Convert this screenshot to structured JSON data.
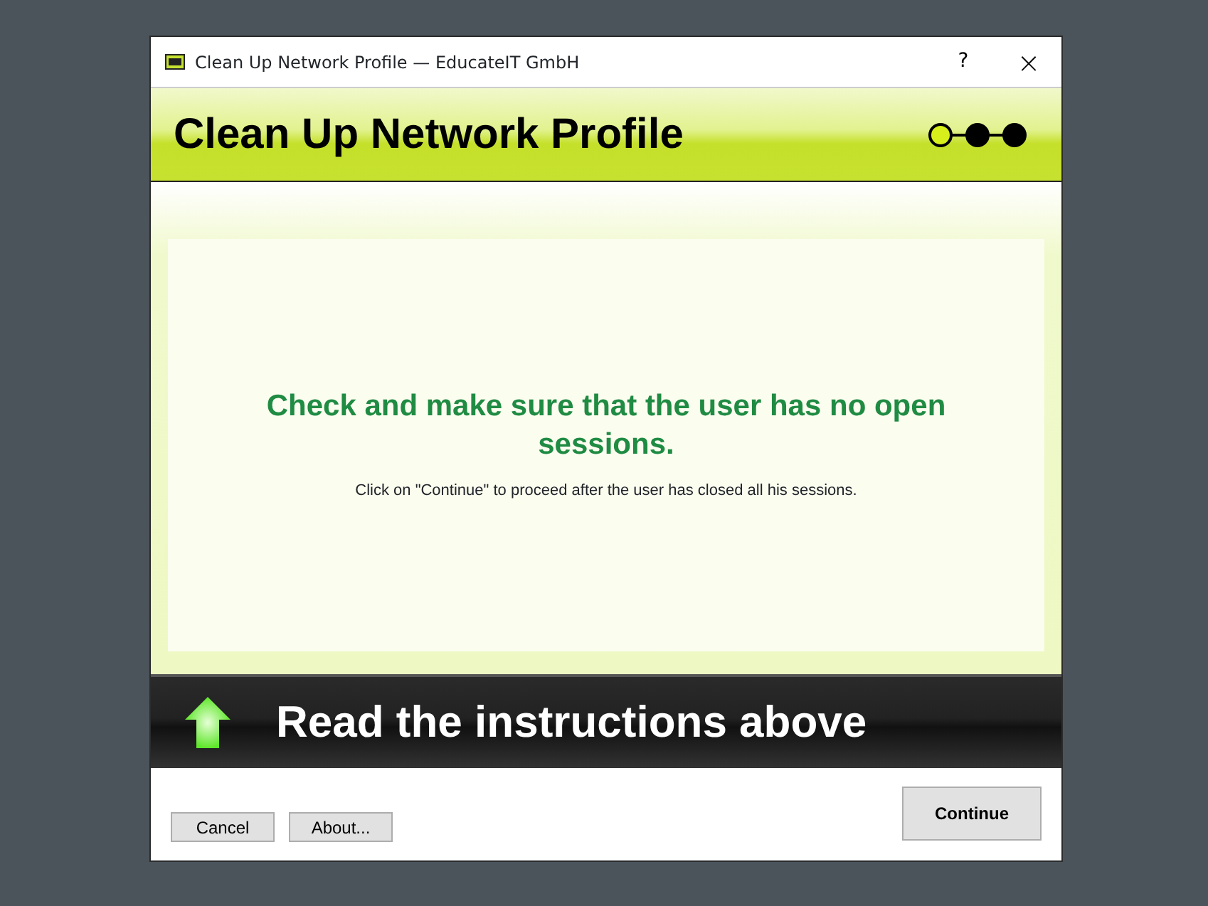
{
  "window": {
    "title": "Clean Up Network Profile — EducateIT GmbH",
    "help": "?",
    "close": "×"
  },
  "header": {
    "title": "Clean Up Network Profile",
    "steps": [
      {
        "selected": true
      },
      {
        "selected": false
      },
      {
        "selected": false
      }
    ]
  },
  "message": {
    "heading": "Check and make sure that the user has no open sessions.",
    "text": "Click on \"Continue\" to proceed after the user has closed all his sessions."
  },
  "banner": {
    "text": "Read the instructions above"
  },
  "buttons": [
    {
      "label": "Cancel",
      "kind": "small"
    },
    {
      "label": "About...",
      "kind": "small"
    },
    {
      "label": "Continue",
      "kind": "primary"
    }
  ]
}
